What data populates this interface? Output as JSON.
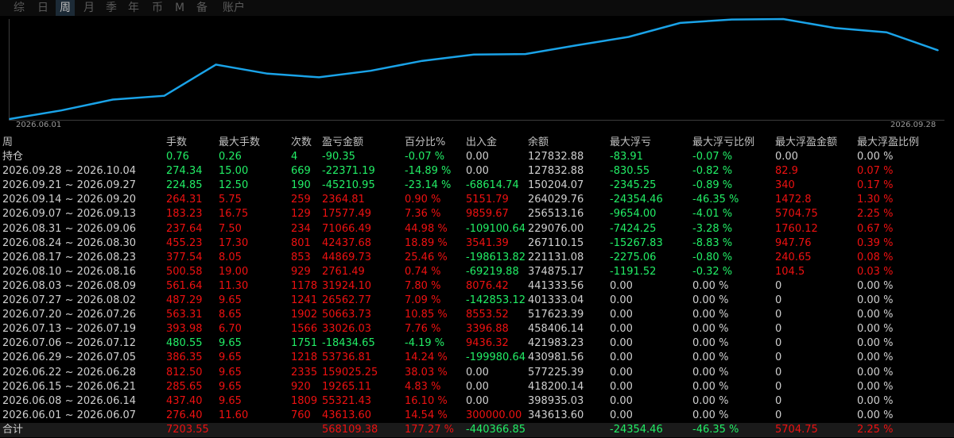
{
  "colors": {
    "positive": "#ee1111",
    "negative": "#22ee66",
    "neutral": "#d0d0d0",
    "line": "#1aa3e8",
    "background": "#000000"
  },
  "tabs": [
    {
      "label": "综",
      "active": false
    },
    {
      "label": "日",
      "active": false
    },
    {
      "label": "周",
      "active": true
    },
    {
      "label": "月",
      "active": false
    },
    {
      "label": "季",
      "active": false
    },
    {
      "label": "年",
      "active": false
    },
    {
      "label": "币",
      "active": false
    },
    {
      "label": "M",
      "active": false
    },
    {
      "label": "备",
      "active": false
    },
    {
      "label": "账户",
      "active": false
    }
  ],
  "chart_data": {
    "type": "line",
    "x_start_label": "2026.06.01",
    "x_end_label": "2026.09.28",
    "x": [
      "2026.06.01",
      "2026.06.08",
      "2026.06.15",
      "2026.06.22",
      "2026.06.29",
      "2026.07.06",
      "2026.07.13",
      "2026.07.20",
      "2026.07.27",
      "2026.08.03",
      "2026.08.10",
      "2026.08.17",
      "2026.08.24",
      "2026.08.31",
      "2026.09.07",
      "2026.09.14",
      "2026.09.21",
      "2026.09.28",
      "2026.10.05"
    ],
    "values": [
      0,
      43613.6,
      98934.9,
      118200,
      277225,
      230980,
      212546,
      245572,
      296135,
      328061,
      330822,
      375691,
      418134,
      489200,
      506777,
      509141,
      463931,
      441560,
      350000
    ]
  },
  "table": {
    "headers": [
      "周",
      "手数",
      "最大手数",
      "次数",
      "盈亏金额",
      "百分比%",
      "出入金",
      "余额",
      "最大浮亏",
      "最大浮亏比例",
      "最大浮盈金额",
      "最大浮盈比例"
    ],
    "rows": [
      {
        "cells": [
          "持仓",
          "0.76",
          "0.26",
          "4",
          "-90.35",
          "-0.07 %",
          "0.00",
          "127832.88",
          "-83.91",
          "-0.07 %",
          "0.00",
          "0.00 %"
        ],
        "colors": [
          "w",
          "g",
          "g",
          "g",
          "g",
          "g",
          "w",
          "w",
          "g",
          "g",
          "w",
          "w"
        ]
      },
      {
        "cells": [
          "2026.09.28 ~ 2026.10.04",
          "274.34",
          "15.00",
          "669",
          "-22371.19",
          "-14.89 %",
          "0.00",
          "127832.88",
          "-830.55",
          "-0.82 %",
          "82.9",
          "0.07 %"
        ],
        "colors": [
          "w",
          "g",
          "g",
          "g",
          "g",
          "g",
          "w",
          "w",
          "g",
          "g",
          "r",
          "r"
        ]
      },
      {
        "cells": [
          "2026.09.21 ~ 2026.09.27",
          "224.85",
          "12.50",
          "190",
          "-45210.95",
          "-23.14 %",
          "-68614.74",
          "150204.07",
          "-2345.25",
          "-0.89 %",
          "340",
          "0.17 %"
        ],
        "colors": [
          "w",
          "g",
          "g",
          "g",
          "g",
          "g",
          "g",
          "w",
          "g",
          "g",
          "r",
          "r"
        ]
      },
      {
        "cells": [
          "2026.09.14 ~ 2026.09.20",
          "264.31",
          "5.75",
          "259",
          "2364.81",
          "0.90 %",
          "5151.79",
          "264029.76",
          "-24354.46",
          "-46.35 %",
          "1472.8",
          "1.30 %"
        ],
        "colors": [
          "w",
          "r",
          "r",
          "r",
          "r",
          "r",
          "r",
          "w",
          "g",
          "g",
          "r",
          "r"
        ]
      },
      {
        "cells": [
          "2026.09.07 ~ 2026.09.13",
          "183.23",
          "16.75",
          "129",
          "17577.49",
          "7.36 %",
          "9859.67",
          "256513.16",
          "-9654.00",
          "-4.01 %",
          "5704.75",
          "2.25 %"
        ],
        "colors": [
          "w",
          "r",
          "r",
          "r",
          "r",
          "r",
          "r",
          "w",
          "g",
          "g",
          "r",
          "r"
        ]
      },
      {
        "cells": [
          "2026.08.31 ~ 2026.09.06",
          "237.64",
          "7.50",
          "234",
          "71066.49",
          "44.98 %",
          "-109100.64",
          "229076.00",
          "-7424.25",
          "-3.28 %",
          "1760.12",
          "0.67 %"
        ],
        "colors": [
          "w",
          "r",
          "r",
          "r",
          "r",
          "r",
          "g",
          "w",
          "g",
          "g",
          "r",
          "r"
        ]
      },
      {
        "cells": [
          "2026.08.24 ~ 2026.08.30",
          "455.23",
          "17.30",
          "801",
          "42437.68",
          "18.89 %",
          "3541.39",
          "267110.15",
          "-15267.83",
          "-8.83 %",
          "947.76",
          "0.39 %"
        ],
        "colors": [
          "w",
          "r",
          "r",
          "r",
          "r",
          "r",
          "r",
          "w",
          "g",
          "g",
          "r",
          "r"
        ]
      },
      {
        "cells": [
          "2026.08.17 ~ 2026.08.23",
          "377.54",
          "8.05",
          "853",
          "44869.73",
          "25.46 %",
          "-198613.82",
          "221131.08",
          "-2275.06",
          "-0.80 %",
          "240.65",
          "0.08 %"
        ],
        "colors": [
          "w",
          "r",
          "r",
          "r",
          "r",
          "r",
          "g",
          "w",
          "g",
          "g",
          "r",
          "r"
        ]
      },
      {
        "cells": [
          "2026.08.10 ~ 2026.08.16",
          "500.58",
          "19.00",
          "929",
          "2761.49",
          "0.74 %",
          "-69219.88",
          "374875.17",
          "-1191.52",
          "-0.32 %",
          "104.5",
          "0.03 %"
        ],
        "colors": [
          "w",
          "r",
          "r",
          "r",
          "r",
          "r",
          "g",
          "w",
          "g",
          "g",
          "r",
          "r"
        ]
      },
      {
        "cells": [
          "2026.08.03 ~ 2026.08.09",
          "561.64",
          "11.30",
          "1178",
          "31924.10",
          "7.80 %",
          "8076.42",
          "441333.56",
          "0.00",
          "0.00 %",
          "0",
          "0.00 %"
        ],
        "colors": [
          "w",
          "r",
          "r",
          "r",
          "r",
          "r",
          "r",
          "w",
          "w",
          "w",
          "w",
          "w"
        ]
      },
      {
        "cells": [
          "2026.07.27 ~ 2026.08.02",
          "487.29",
          "9.65",
          "1241",
          "26562.77",
          "7.09 %",
          "-142853.12",
          "401333.04",
          "0.00",
          "0.00 %",
          "0",
          "0.00 %"
        ],
        "colors": [
          "w",
          "r",
          "r",
          "r",
          "r",
          "r",
          "g",
          "w",
          "w",
          "w",
          "w",
          "w"
        ]
      },
      {
        "cells": [
          "2026.07.20 ~ 2026.07.26",
          "563.31",
          "8.65",
          "1902",
          "50663.73",
          "10.85 %",
          "8553.52",
          "517623.39",
          "0.00",
          "0.00 %",
          "0",
          "0.00 %"
        ],
        "colors": [
          "w",
          "r",
          "r",
          "r",
          "r",
          "r",
          "r",
          "w",
          "w",
          "w",
          "w",
          "w"
        ]
      },
      {
        "cells": [
          "2026.07.13 ~ 2026.07.19",
          "393.98",
          "6.70",
          "1566",
          "33026.03",
          "7.76 %",
          "3396.88",
          "458406.14",
          "0.00",
          "0.00 %",
          "0",
          "0.00 %"
        ],
        "colors": [
          "w",
          "r",
          "r",
          "r",
          "r",
          "r",
          "r",
          "w",
          "w",
          "w",
          "w",
          "w"
        ]
      },
      {
        "cells": [
          "2026.07.06 ~ 2026.07.12",
          "480.55",
          "9.65",
          "1751",
          "-18434.65",
          "-4.19 %",
          "9436.32",
          "421983.23",
          "0.00",
          "0.00 %",
          "0",
          "0.00 %"
        ],
        "colors": [
          "w",
          "g",
          "g",
          "g",
          "g",
          "g",
          "r",
          "w",
          "w",
          "w",
          "w",
          "w"
        ]
      },
      {
        "cells": [
          "2026.06.29 ~ 2026.07.05",
          "386.35",
          "9.65",
          "1218",
          "53736.81",
          "14.24 %",
          "-199980.64",
          "430981.56",
          "0.00",
          "0.00 %",
          "0",
          "0.00 %"
        ],
        "colors": [
          "w",
          "r",
          "r",
          "r",
          "r",
          "r",
          "g",
          "w",
          "w",
          "w",
          "w",
          "w"
        ]
      },
      {
        "cells": [
          "2026.06.22 ~ 2026.06.28",
          "812.50",
          "9.65",
          "2335",
          "159025.25",
          "38.03 %",
          "0.00",
          "577225.39",
          "0.00",
          "0.00 %",
          "0",
          "0.00 %"
        ],
        "colors": [
          "w",
          "r",
          "r",
          "r",
          "r",
          "r",
          "w",
          "w",
          "w",
          "w",
          "w",
          "w"
        ]
      },
      {
        "cells": [
          "2026.06.15 ~ 2026.06.21",
          "285.65",
          "9.65",
          "920",
          "19265.11",
          "4.83 %",
          "0.00",
          "418200.14",
          "0.00",
          "0.00 %",
          "0",
          "0.00 %"
        ],
        "colors": [
          "w",
          "r",
          "r",
          "r",
          "r",
          "r",
          "w",
          "w",
          "w",
          "w",
          "w",
          "w"
        ]
      },
      {
        "cells": [
          "2026.06.08 ~ 2026.06.14",
          "437.40",
          "9.65",
          "1809",
          "55321.43",
          "16.10 %",
          "0.00",
          "398935.03",
          "0.00",
          "0.00 %",
          "0",
          "0.00 %"
        ],
        "colors": [
          "w",
          "r",
          "r",
          "r",
          "r",
          "r",
          "w",
          "w",
          "w",
          "w",
          "w",
          "w"
        ]
      },
      {
        "cells": [
          "2026.06.01 ~ 2026.06.07",
          "276.40",
          "11.60",
          "760",
          "43613.60",
          "14.54 %",
          "300000.00",
          "343613.60",
          "0.00",
          "0.00 %",
          "0",
          "0.00 %"
        ],
        "colors": [
          "w",
          "r",
          "r",
          "r",
          "r",
          "r",
          "r",
          "w",
          "w",
          "w",
          "w",
          "w"
        ]
      }
    ],
    "total": {
      "cells": [
        "合计",
        "7203.55",
        "",
        "",
        "568109.38",
        "177.27 %",
        "-440366.85",
        "",
        "-24354.46",
        "-46.35 %",
        "5704.75",
        "2.25 %"
      ],
      "colors": [
        "w",
        "r",
        "w",
        "w",
        "r",
        "r",
        "g",
        "w",
        "g",
        "g",
        "r",
        "r"
      ]
    }
  }
}
